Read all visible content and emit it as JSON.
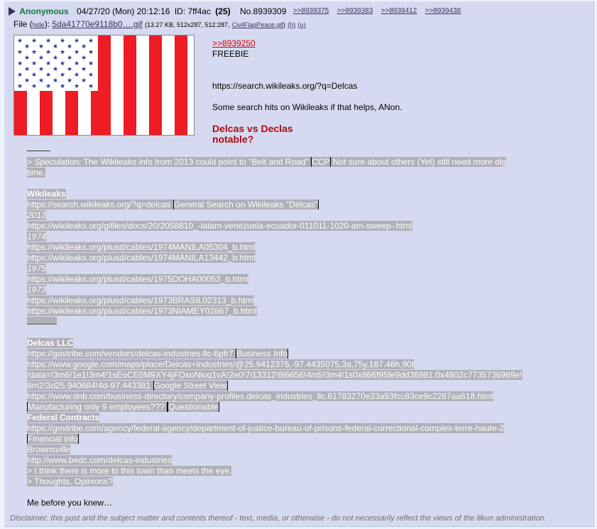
{
  "post": {
    "name": "Anonymous",
    "date": "04/27/20 (Mon) 20:12:16",
    "id_label": "ID: 7ff4ac",
    "id_count": "(25)",
    "number": "No.8939309",
    "backlinks": [
      ">>8939375",
      ">>8939383",
      ">>8939412",
      ">>8939438"
    ]
  },
  "file": {
    "label": "File (",
    "hide": "hide",
    "after_hide": "):",
    "filename": "5da41770e9118b0….gif",
    "meta": "(13.27 KB, 512x287, 512:287,",
    "orig_name": "CivilFlagPeace.gif",
    "close_paren": ")",
    "h": "(h)",
    "u": "(u)"
  },
  "body1": {
    "quote_link": ">>8939250",
    "freebie": "FREEBIE",
    "search_url": "https://search.wikileaks.org/?q=Delcas",
    "note": "Some search hits on Wikileaks if that helps, ANon.",
    "heading1": "Delcas vs Declas",
    "heading2": "notable?"
  },
  "body2": {
    "speculation_prefix": "> ",
    "speculation_label": "Speculation:",
    "speculation_text": " The Wikileaks info from 2013 could point to \"Belt and Road\" ",
    "ccp": "CCP",
    "speculation_rest": " Not sure about others (Yet) still need more dig",
    "speculation_wrap": "time.",
    "wikileaks_heading": "Wikileaks",
    "wl_search_url": "https://search.wikileaks.org/?q=delcas ",
    "wl_search_label": "General Search on Wikileaks \"Delcas\"",
    "y2013": "2013",
    "wl_2013_url": "https://wikileaks.org/gifiles/docs/20/2058810_-latam-venezuela-ecuador-011011-1020-am-sweep-.html",
    "y1974": "1974",
    "wl_1974_a": "https://wikileaks.org/plusd/cables/1974MANILA05304_b.html",
    "wl_1974_b": "https://wikileaks.org/plusd/cables/1974MANILA13442_b.html",
    "y1975": "1975",
    "wl_1975": "https://wikileaks.org/plusd/cables/1975DOHA00053_b.html",
    "y1973": "1973",
    "wl_1973_a": "https://wikileaks.org/plusd/cables/1973BRASIL02313_b.html",
    "wl_1973_b": "https://wikileaks.org/plusd/cables/1973NIAMEY02867_b.html",
    "delcas_heading": "Delcas LLC",
    "govtribe_url": "https://govtribe.com/vendors/delcas-industries-llc-6pfr7 ",
    "business_info": "Business Info",
    "maps_url_1": "https://www.google.com/maps/place/Delcas+Industries/@25.9412376,-97.4435075,3a,75y,187.46h,90t",
    "maps_url_2": "/data=!3m6!1e1!3m4!1sEoCE0M9XY4jFOxoNloq1vA!2e0!7i13312!8i6656!4m5!3m4!1s0x866f95fe9dd36981:0x4802c7735736969e!",
    "maps_url_3": "8m2!3d25.940684!4d-97.443381 ",
    "street_view": "Google Street View",
    "dnb_url": "https://www.dnb.com/business-directory/company-profiles.delcas_industries_llc.61783270e23a53fcc83ce9c2287aa618.html ",
    "manufacturing": "Manufacturing only 9 employees??? ",
    "questionable": "Questionable",
    "federal_heading": "Federal Contracts",
    "fed_url": "https://govtribe.com/agency/federal-agency/department-of-justice-bureau-of-prisons-federal-correctional-complex-terre-haute-2 ",
    "financial_info": "Financial info",
    "brownsville": "Brownsville",
    "bedc_url": "http://www.bedc.com/delcas-industries",
    "more_to_town": "> I think there is more to this town than meets the eye. ",
    "thoughts": "> Thoughts, Opinions?",
    "me_before": "Me before you knew…"
  },
  "footer": "Disclaimer: this post and the subject matter and contents thereof - text, media, or otherwise - do not necessarily reflect the views of the 8kun administration."
}
